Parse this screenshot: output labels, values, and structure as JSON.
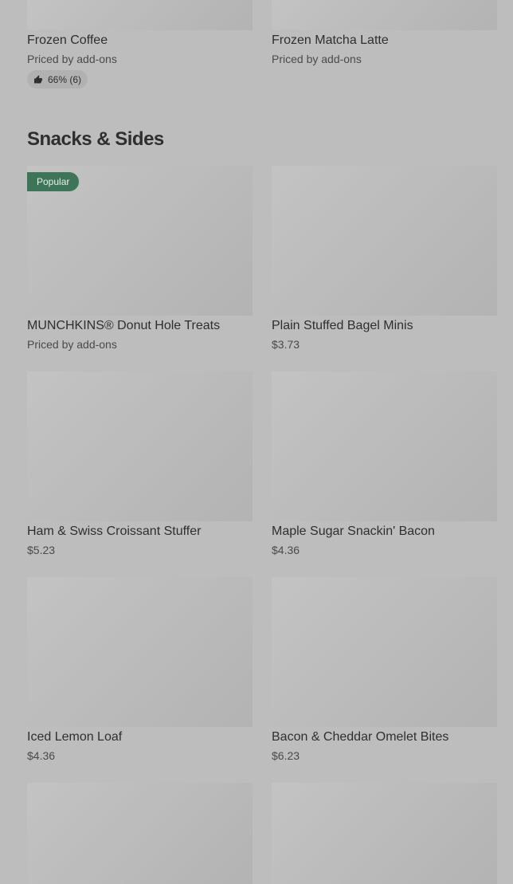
{
  "prev_section": {
    "items": [
      {
        "name": "Frozen Coffee",
        "price": "Priced by add-ons",
        "rating": "66% (6)"
      },
      {
        "name": "Frozen Matcha Latte",
        "price": "Priced by add-ons"
      }
    ]
  },
  "snacks_section": {
    "title": "Snacks & Sides",
    "badge": "Popular",
    "items": [
      {
        "name": "MUNCHKINS® Donut Hole Treats",
        "price": "Priced by add-ons"
      },
      {
        "name": "Plain Stuffed Bagel Minis",
        "price": "$3.73"
      },
      {
        "name": "Ham & Swiss Croissant Stuffer",
        "price": "$5.23"
      },
      {
        "name": "Maple Sugar Snackin' Bacon",
        "price": "$4.36"
      },
      {
        "name": "Iced Lemon Loaf",
        "price": "$4.36"
      },
      {
        "name": "Bacon & Cheddar Omelet Bites",
        "price": "$6.23"
      }
    ]
  },
  "icons": {
    "rating": "thumbs-up-icon"
  }
}
